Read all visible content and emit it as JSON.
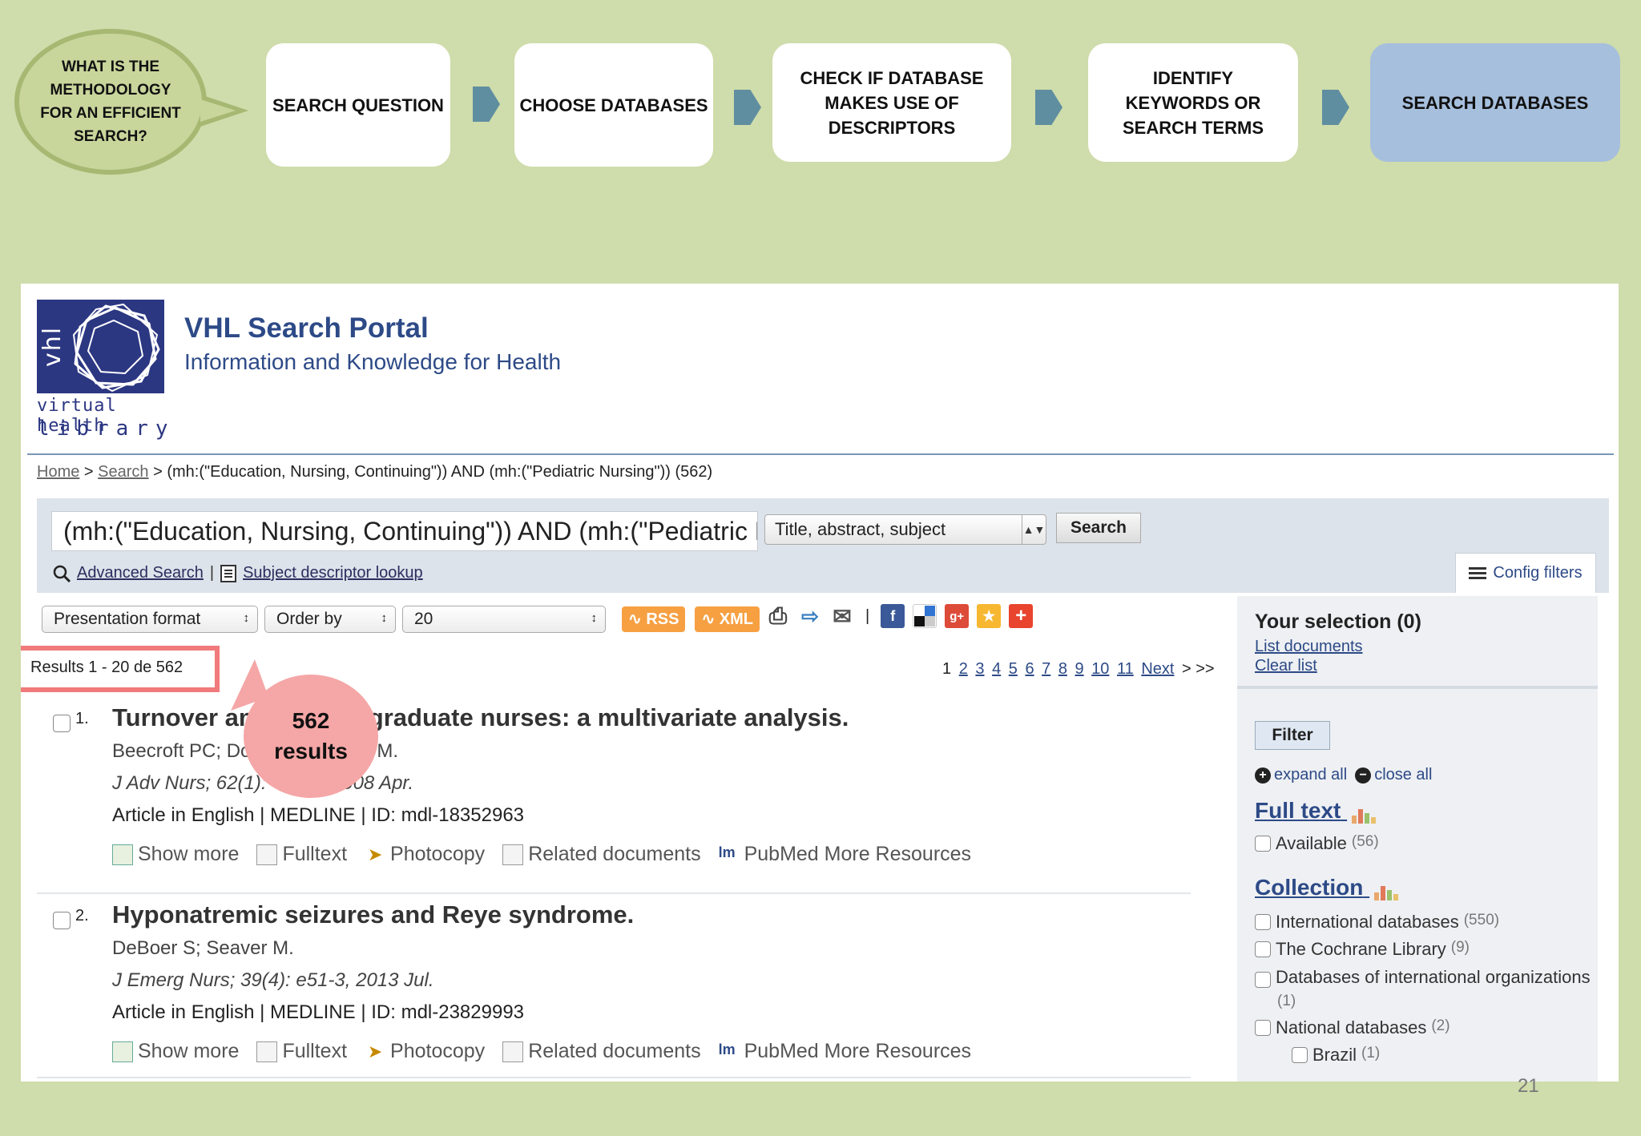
{
  "methodology": {
    "question": "WHAT IS THE METHODOLOGY FOR AN EFFICIENT SEARCH?",
    "steps": [
      "SEARCH QUESTION",
      "CHOOSE DATABASES",
      "CHECK IF DATABASE MAKES USE OF DESCRIPTORS",
      "IDENTIFY KEYWORDS OR SEARCH TERMS",
      "SEARCH DATABASES"
    ],
    "active_step": 4
  },
  "portal": {
    "logo_vertical": "vhl",
    "logo_line1": "virtual health",
    "logo_line2": "library",
    "title": "VHL Search Portal",
    "subtitle": "Information and Knowledge for Health"
  },
  "breadcrumb": {
    "home": "Home",
    "sep1": ">",
    "search": "Search",
    "current": "> (mh:(\"Education, Nursing, Continuing\")) AND (mh:(\"Pediatric Nursing\")) (562)"
  },
  "search": {
    "query": "(mh:(\"Education, Nursing, Continuing\")) AND (mh:(\"Pediatric Nursing\"))",
    "field": "Title, abstract, subject",
    "button": "Search",
    "advanced": "Advanced Search",
    "pipe": "|",
    "descriptor": "Subject descriptor lookup",
    "config_filters": "Config filters"
  },
  "toolbar": {
    "presentation": "Presentation format",
    "order": "Order by",
    "per_page": "20",
    "rss": "RSS",
    "xml": "XML",
    "separator": "|"
  },
  "results": {
    "label": "Results 1 - 20 de 562",
    "callout": "562 results",
    "pages": [
      "1",
      "2",
      "3",
      "4",
      "5",
      "6",
      "7",
      "8",
      "9",
      "10",
      "11"
    ],
    "next": "Next",
    "last": "> >>"
  },
  "records": [
    {
      "num": "1.",
      "title": "Turnover among new graduate nurses: a multivariate analysis.",
      "authors": "Beecroft PC; Dorey F; Wenten M.",
      "journal": "J Adv Nurs; 62(1): 41-52, 2008 Apr.",
      "meta": "Article in English | MEDLINE | ID: mdl-18352963"
    },
    {
      "num": "2.",
      "title": "Hyponatremic seizures and Reye syndrome.",
      "authors": "DeBoer S; Seaver M.",
      "journal": "J Emerg Nurs; 39(4): e51-3, 2013 Jul.",
      "meta": "Article in English | MEDLINE | ID: mdl-23829993"
    }
  ],
  "record_links": {
    "show_more": "Show more",
    "fulltext": "Fulltext",
    "photocopy": "Photocopy",
    "related": "Related documents",
    "pubmed": "PubMed More Resources"
  },
  "sidebar": {
    "selection": "Your selection (0)",
    "list_documents": "List documents",
    "clear_list": "Clear list",
    "filter": "Filter",
    "expand_all": "expand all",
    "close_all": "close all",
    "fulltext_heading": "Full text",
    "available": "Available",
    "available_count": "(56)",
    "collection_heading": "Collection",
    "collections": [
      {
        "label": "International databases",
        "count": "(550)"
      },
      {
        "label": "The Cochrane Library",
        "count": "(9)"
      },
      {
        "label": "Databases of international organizations",
        "count": "(1)"
      },
      {
        "label": "National databases",
        "count": "(2)"
      },
      {
        "label": "Brazil",
        "count": "(1)"
      }
    ]
  },
  "slide_number": "21"
}
